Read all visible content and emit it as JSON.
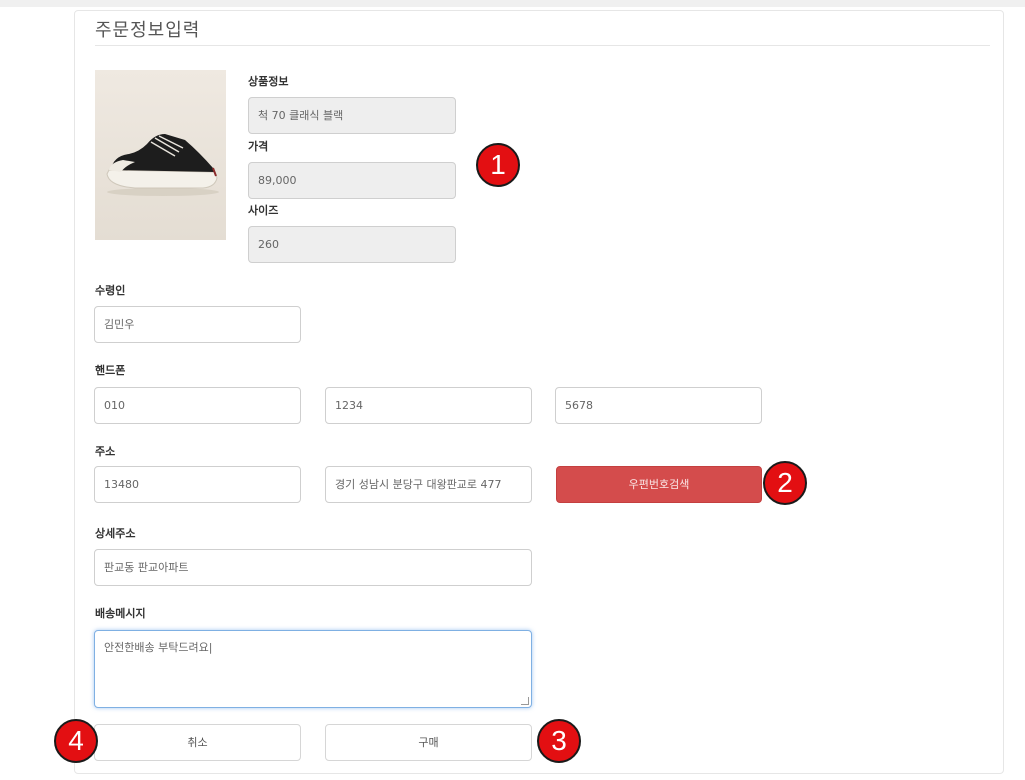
{
  "page_title": "주문정보입력",
  "product": {
    "image_icon": "sneaker-icon",
    "info_label": "상품정보",
    "name_value": "척 70 클래식 블랙",
    "price_label": "가격",
    "price_value": "89,000",
    "size_label": "사이즈",
    "size_value": "260"
  },
  "recipient": {
    "label": "수령인",
    "value": "김민우"
  },
  "phone": {
    "label": "핸드폰",
    "part1": "010",
    "part2": "1234",
    "part3": "5678"
  },
  "address": {
    "label": "주소",
    "zipcode": "13480",
    "street": "경기 성남시 분당구 대왕판교로 477",
    "search_button": "우편번호검색",
    "detail_label": "상세주소",
    "detail_value": "판교동 판교아파트"
  },
  "delivery": {
    "label": "배송메시지",
    "message": "안전한배송 부탁드려요|"
  },
  "actions": {
    "cancel": "취소",
    "purchase": "구매"
  },
  "annotations": [
    "1",
    "2",
    "3",
    "4"
  ],
  "colors": {
    "accent_red": "#d44c4c",
    "badge_red": "#e30f12",
    "focus_blue": "#7fb0e3"
  }
}
